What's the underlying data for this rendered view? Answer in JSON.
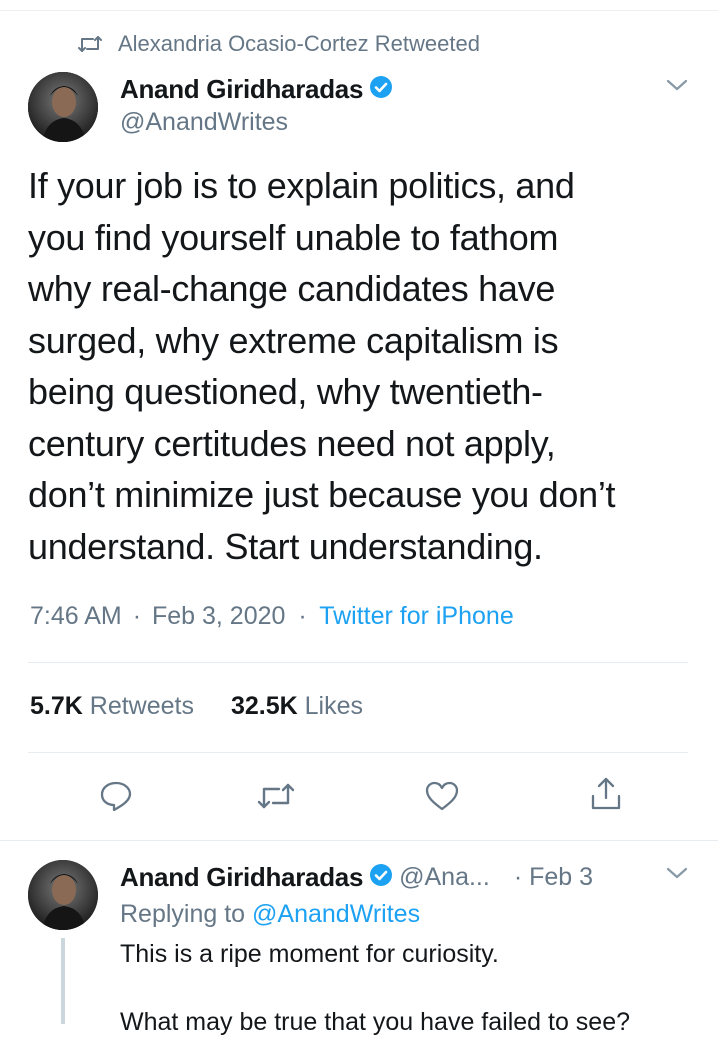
{
  "retweet_context": {
    "icon": "retweet-icon",
    "text": "Alexandria Ocasio-Cortez Retweeted"
  },
  "tweet": {
    "author_name": "Anand Giridharadas",
    "author_handle": "@AnandWrites",
    "lines": [
      "If your job is to explain politics, and",
      "you find yourself unable to fathom",
      "why real-change candidates have",
      "surged, why extreme capitalism is",
      "being questioned, why twentieth-",
      "century certitudes need not apply,",
      "don’t minimize just because you don’t",
      "understand. Start understanding."
    ],
    "time": "7:46 AM",
    "separator": "·",
    "date": "Feb 3, 2020",
    "source": "Twitter for iPhone",
    "retweets_count": "5.7K",
    "retweets_label": "Retweets",
    "likes_count": "32.5K",
    "likes_label": "Likes"
  },
  "actions": [
    "reply-icon",
    "retweet-icon",
    "like-icon",
    "share-icon"
  ],
  "reply": {
    "author_name": "Anand Giridharadas",
    "author_handle": "@Ana...",
    "date": "· Feb 3",
    "replying_prefix": "Replying to",
    "replying_handle": "@AnandWrites",
    "line1": "This is a ripe moment for curiosity.",
    "line2": "What may be true that you have failed to see?"
  },
  "colors": {
    "accent": "#1da1f2",
    "muted": "#657786",
    "text": "#14171a",
    "divider": "#e6ecf0"
  }
}
